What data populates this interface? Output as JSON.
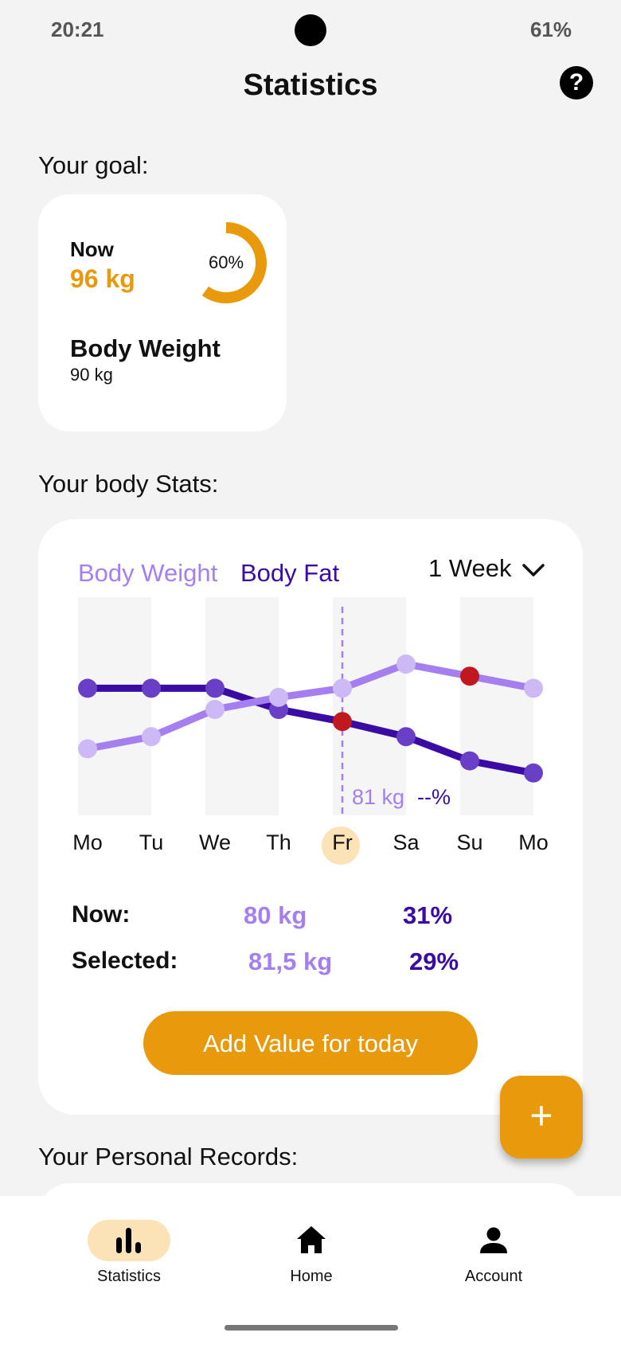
{
  "status_bar": {
    "time": "20:21",
    "battery": "61%"
  },
  "header": {
    "title": "Statistics",
    "help_icon": "help-icon"
  },
  "goal": {
    "section_title": "Your goal:",
    "now_label": "Now",
    "now_value": "96 kg",
    "progress_percent": 60,
    "progress_label": "60%",
    "target_label": "Body Weight",
    "target_value": "90 kg"
  },
  "body_stats": {
    "section_title": "Your body Stats:",
    "legend": {
      "weight": "Body Weight",
      "fat": "Body Fat"
    },
    "range": "1 Week",
    "tooltip": {
      "weight": "81 kg",
      "fat": "--%"
    },
    "days": [
      "Mo",
      "Tu",
      "We",
      "Th",
      "Fr",
      "Sa",
      "Su",
      "Mo"
    ],
    "selected_day_index": 4,
    "now_label": "Now:",
    "now_weight": "80 kg",
    "now_fat": "31%",
    "selected_label": "Selected:",
    "selected_weight": "81,5 kg",
    "selected_fat": "29%",
    "add_button": "Add Value for today"
  },
  "fab": {
    "label": "+"
  },
  "records": {
    "section_title": "Your Personal Records:"
  },
  "nav": {
    "items": [
      {
        "label": "Statistics",
        "icon": "bar-chart-icon"
      },
      {
        "label": "Home",
        "icon": "home-icon"
      },
      {
        "label": "Account",
        "icon": "person-icon"
      }
    ]
  },
  "colors": {
    "accent": "#e89a0c",
    "weight_line": "#a57ff0",
    "weight_point": "#cdb9f5",
    "fat_line": "#3a0ca3",
    "fat_point": "#6a3fc8",
    "marker": "#c0181f"
  },
  "chart_data": {
    "type": "line",
    "categories": [
      "Mo",
      "Tu",
      "We",
      "Th",
      "Fr",
      "Sa",
      "Su",
      "Mo"
    ],
    "series": [
      {
        "name": "Body Weight",
        "values": [
          79.2,
          79.6,
          80.5,
          80.9,
          81.2,
          82.0,
          81.6,
          81.2
        ]
      },
      {
        "name": "Body Fat",
        "values": [
          81.2,
          81.2,
          81.2,
          80.5,
          80.1,
          79.6,
          78.8,
          78.4
        ]
      }
    ],
    "selected_index": 4,
    "highlight": [
      {
        "series": "Body Weight",
        "index": 6
      },
      {
        "series": "Body Fat",
        "index": 4
      }
    ],
    "xlabel": "",
    "ylabel": "",
    "grid": false,
    "legend": "top-left"
  }
}
